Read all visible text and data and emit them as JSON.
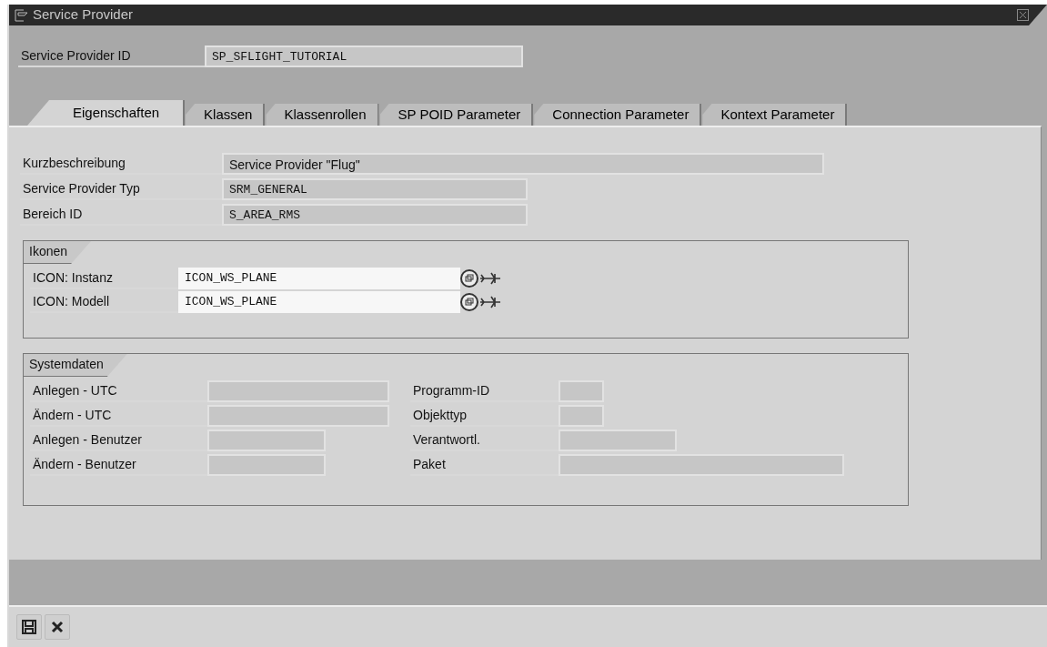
{
  "window": {
    "title": "Service Provider"
  },
  "header": {
    "label": "Service Provider ID",
    "value": "SP_SFLIGHT_TUTORIAL"
  },
  "tabs": [
    {
      "label": "Eigenschaften",
      "selected": true
    },
    {
      "label": "Klassen",
      "selected": false
    },
    {
      "label": "Klassenrollen",
      "selected": false
    },
    {
      "label": "SP POID Parameter",
      "selected": false
    },
    {
      "label": "Connection Parameter",
      "selected": false
    },
    {
      "label": "Kontext Parameter",
      "selected": false
    }
  ],
  "fields": [
    {
      "label": "Kurzbeschreibung",
      "value": "Service Provider \"Flug\"",
      "kind": "text"
    },
    {
      "label": "Service Provider Typ",
      "value": "SRM_GENERAL",
      "kind": "code"
    },
    {
      "label": "Bereich ID",
      "value": "S_AREA_RMS",
      "kind": "code"
    }
  ],
  "icons_group": {
    "title": "Ikonen",
    "rows": [
      {
        "label": "ICON: Instanz",
        "value": "ICON_WS_PLANE"
      },
      {
        "label": "ICON: Modell",
        "value": "ICON_WS_PLANE"
      }
    ]
  },
  "system_group": {
    "title": "Systemdaten",
    "left": [
      {
        "label": "Anlegen - UTC"
      },
      {
        "label": "Ändern - UTC"
      },
      {
        "label": "Anlegen - Benutzer"
      },
      {
        "label": "Ändern - Benutzer"
      }
    ],
    "right": [
      {
        "label": "Programm-ID"
      },
      {
        "label": "Objekttyp"
      },
      {
        "label": "Verantwortl."
      },
      {
        "label": "Paket"
      }
    ]
  }
}
